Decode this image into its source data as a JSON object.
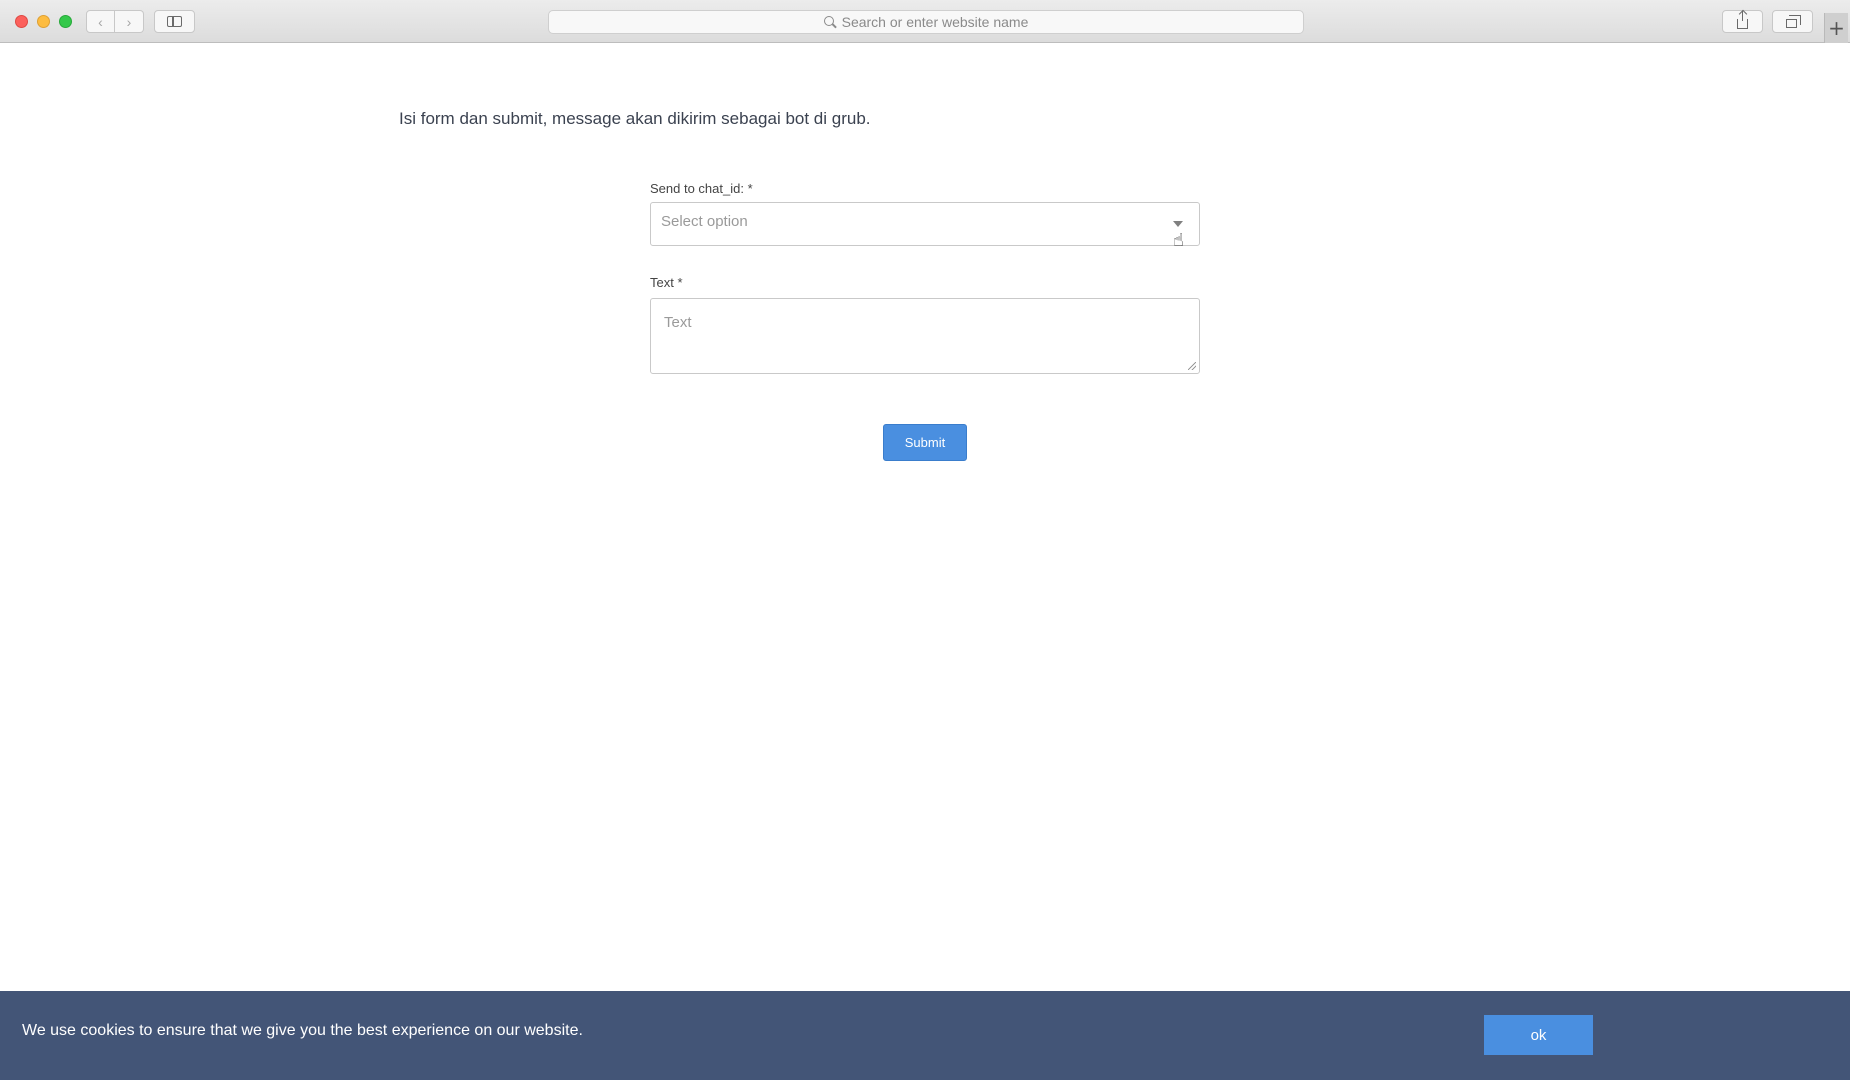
{
  "browser": {
    "address_bar_placeholder": "Search or enter website name",
    "icons": {
      "back": "chevron-left-icon",
      "forward": "chevron-right-icon",
      "sidebar": "sidebar-icon",
      "search": "search-icon",
      "share": "share-icon",
      "tabs": "tab-overview-icon",
      "new_tab": "plus-icon"
    },
    "new_tab_label": "+"
  },
  "page": {
    "intro_text": "Isi form dan submit, message akan dikirim sebagai bot di grub.",
    "form": {
      "chat_label": "Send to chat_id: *",
      "chat_placeholder": "Select option",
      "text_label": "Text *",
      "text_placeholder": "Text",
      "submit_label": "Submit"
    }
  },
  "cookie_banner": {
    "message": "We use cookies to ensure that we give you the best experience on our website.",
    "ok_label": "ok"
  },
  "colors": {
    "accent": "#4a8fe0",
    "banner_bg": "#435577"
  }
}
